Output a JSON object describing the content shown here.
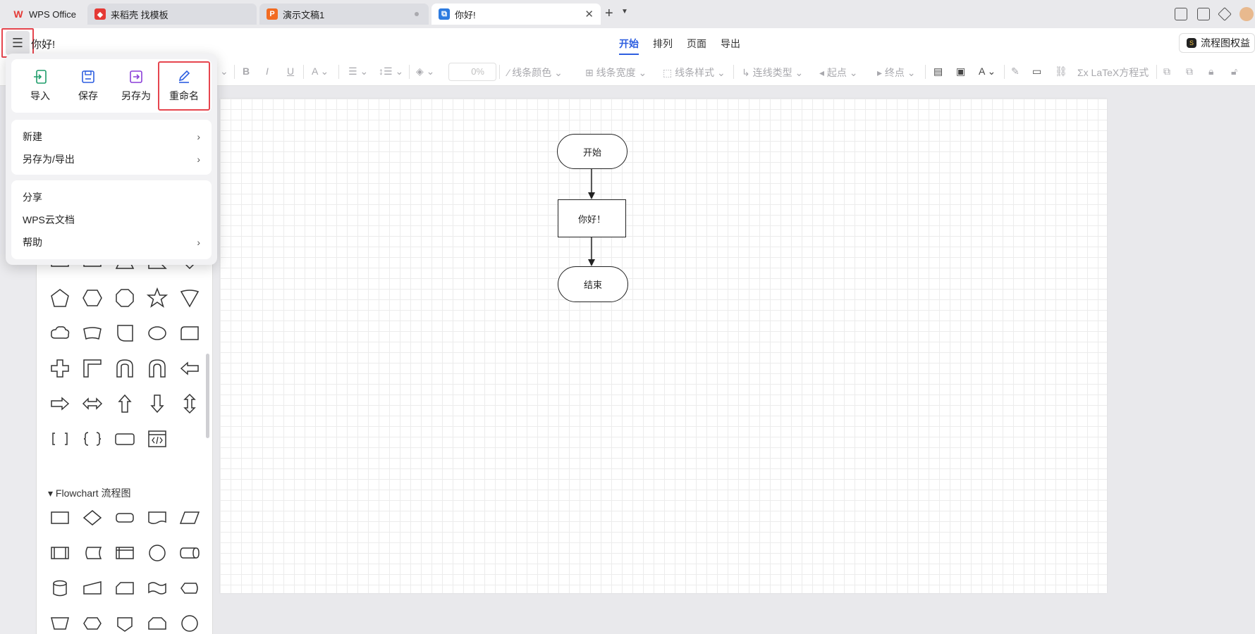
{
  "tabs": [
    {
      "label": "WPS Office",
      "icon": "wps-logo-icon"
    },
    {
      "label": "来稻壳 找模板",
      "icon": "daoke-icon"
    },
    {
      "label": "演示文稿1",
      "icon": "presentation-icon",
      "icon_letter": "P"
    },
    {
      "label": "你好!",
      "icon": "flowchart-doc-icon"
    }
  ],
  "doc": {
    "title": "你好!"
  },
  "menu_tabs": [
    "开始",
    "排列",
    "页面",
    "导出"
  ],
  "header": {
    "rights_button": "流程图权益"
  },
  "toolbar": {
    "opacity": "0%",
    "line_color": "线条颜色",
    "line_width": "线条宽度",
    "line_style": "线条样式",
    "connector_type": "连线类型",
    "start_point": "起点",
    "end_point": "终点",
    "latex": "LaTeX方程式"
  },
  "file_menu": {
    "quick_actions": [
      {
        "label": "导入",
        "icon": "import-icon",
        "color": "#1f9d6b"
      },
      {
        "label": "保存",
        "icon": "save-icon",
        "color": "#2d5ee0"
      },
      {
        "label": "另存为",
        "icon": "save-as-icon",
        "color": "#8b3fd8"
      },
      {
        "label": "重命名",
        "icon": "rename-icon",
        "color": "#2d5ee0"
      }
    ],
    "group1": [
      {
        "label": "新建",
        "has_submenu": true
      },
      {
        "label": "另存为/导出",
        "has_submenu": true
      }
    ],
    "group2": [
      {
        "label": "分享",
        "has_submenu": false
      },
      {
        "label": "WPS云文档",
        "has_submenu": false
      },
      {
        "label": "帮助",
        "has_submenu": true
      }
    ]
  },
  "shape_panel": {
    "section_title": "Flowchart 流程图"
  },
  "flowchart": {
    "nodes": [
      {
        "label": "开始",
        "shape": "terminal"
      },
      {
        "label": "你好！",
        "shape": "process"
      },
      {
        "label": "结束",
        "shape": "terminal"
      }
    ]
  },
  "colors": {
    "accent": "#2d5ee0",
    "highlight": "#e6454e",
    "wps_red": "#e53935",
    "presentation_orange": "#f26b21",
    "flowchart_blue": "#2d7be0"
  }
}
